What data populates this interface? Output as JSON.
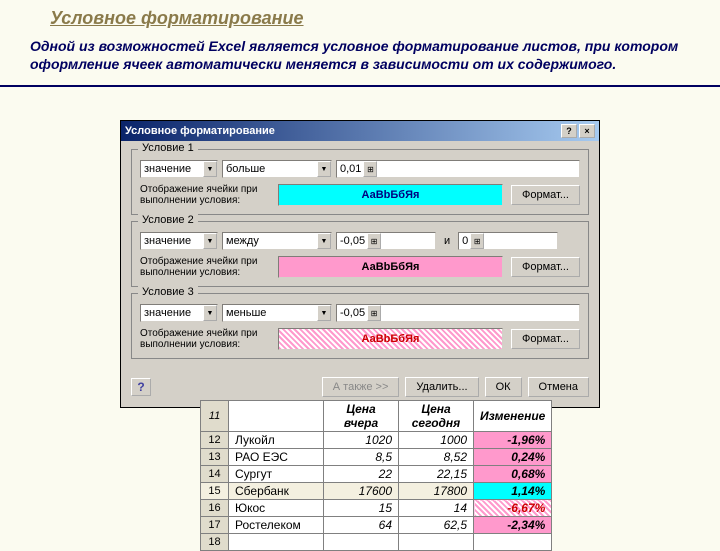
{
  "title": "Условное форматирование",
  "description": "Одной из возможностей Excel является условное форматирование листов, при котором оформление ячеек автоматически меняется в зависимости от их содержимого.",
  "dialog": {
    "title": "Условное форматирование",
    "help_tip": "?",
    "close_tip": "×",
    "conditions": [
      {
        "label": "Условие 1",
        "type": "значение",
        "op": "больше",
        "v1": "0,01",
        "and": "",
        "v2": "",
        "preview_label": "Отображение ячейки при выполнении условия:",
        "sample": "АаВbБбЯя",
        "format_btn": "Формат..."
      },
      {
        "label": "Условие 2",
        "type": "значение",
        "op": "между",
        "v1": "-0,05",
        "and": "и",
        "v2": "0",
        "preview_label": "Отображение ячейки при выполнении условия:",
        "sample": "АаВbБбЯя",
        "format_btn": "Формат..."
      },
      {
        "label": "Условие 3",
        "type": "значение",
        "op": "меньше",
        "v1": "-0,05",
        "and": "",
        "v2": "",
        "preview_label": "Отображение ячейки при выполнении условия:",
        "sample": "АаВbБбЯя",
        "format_btn": "Формат..."
      }
    ],
    "footer": {
      "also": "А также >>",
      "delete": "Удалить...",
      "ok": "ОК",
      "cancel": "Отмена",
      "help": "?"
    }
  },
  "sheet": {
    "headers": [
      "",
      "Цена вчера",
      "Цена сегодня",
      "Изменение"
    ],
    "rownums": [
      "11",
      "12",
      "13",
      "14",
      "15",
      "16",
      "17",
      "18"
    ],
    "rows": [
      {
        "name": "Лукойл",
        "y": "1020",
        "t": "1000",
        "c": "-1,96%",
        "cls": "chg-pink"
      },
      {
        "name": "РАО ЕЭС",
        "y": "8,5",
        "t": "8,52",
        "c": "0,24%",
        "cls": "chg-pink"
      },
      {
        "name": "Сургут",
        "y": "22",
        "t": "22,15",
        "c": "0,68%",
        "cls": "chg-pink"
      },
      {
        "name": "Сбербанк",
        "y": "17600",
        "t": "17800",
        "c": "1,14%",
        "cls": "chg-cyan"
      },
      {
        "name": "Юкос",
        "y": "15",
        "t": "14",
        "c": "-6,67%",
        "cls": "chg-hatch"
      },
      {
        "name": "Ростелеком",
        "y": "64",
        "t": "62,5",
        "c": "-2,34%",
        "cls": "chg-pink"
      }
    ]
  }
}
